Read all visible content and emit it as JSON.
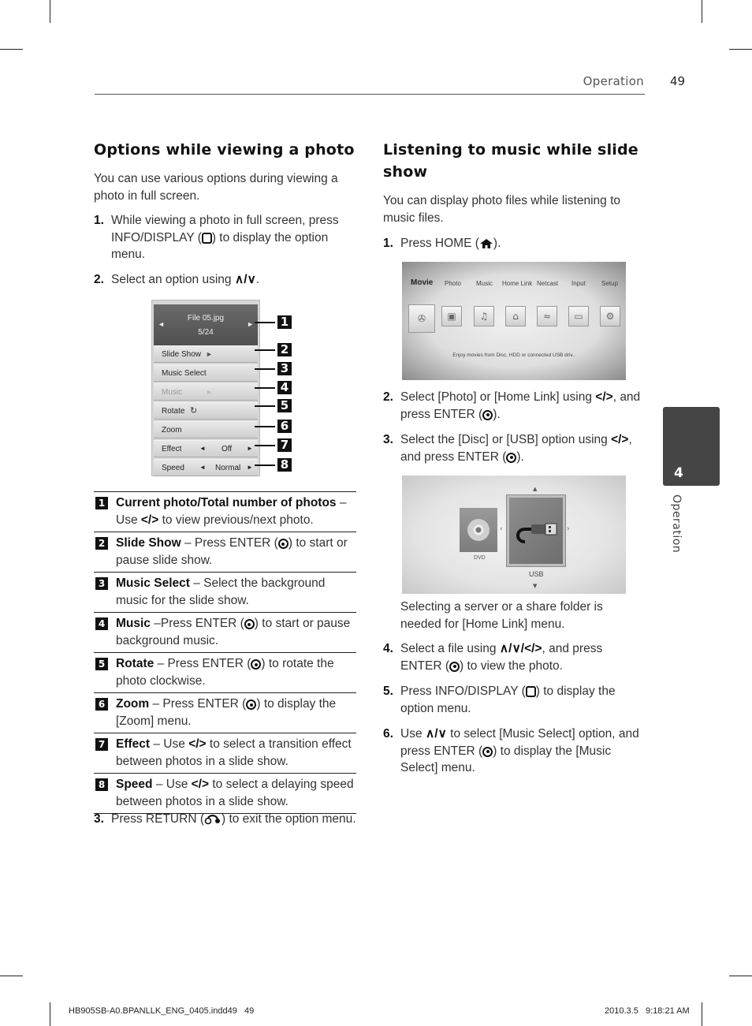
{
  "header": {
    "section": "Operation",
    "page_number": "49"
  },
  "side_tab": {
    "chapter": "4",
    "label": "Operation"
  },
  "left": {
    "title": "Options while viewing a photo",
    "intro": "You can use various options during viewing a photo in full screen.",
    "steps": [
      {
        "num": "1.",
        "pre": "While viewing a photo in full screen, press INFO/DISPLAY (",
        "icon": "info-display-icon",
        "post": ") to display the option menu."
      },
      {
        "num": "2.",
        "pre": "Select an option using ",
        "sym": "∧/∨",
        "post": "."
      }
    ],
    "step3": {
      "num": "3.",
      "pre": "Press RETURN (",
      "icon": "return-icon",
      "post": ") to exit the option menu."
    },
    "option_menu": {
      "file_name": "File 05.jpg",
      "position": "5/24",
      "rows": [
        {
          "label": "Slide Show",
          "extra": "►",
          "dimmed": false
        },
        {
          "label": "Music Select",
          "extra": "",
          "dimmed": false
        },
        {
          "label": "Music",
          "extra": "►",
          "dimmed": true
        },
        {
          "label": "Rotate",
          "extra": "↻",
          "dimmed": false
        },
        {
          "label": "Zoom",
          "extra": "",
          "dimmed": false
        },
        {
          "label": "Effect",
          "value": "Off",
          "dimmed": false
        },
        {
          "label": "Speed",
          "value": "Normal",
          "dimmed": false
        }
      ],
      "callouts": [
        "1",
        "2",
        "3",
        "4",
        "5",
        "6",
        "7",
        "8"
      ]
    },
    "legend": [
      {
        "num": "1",
        "term": "Current photo/Total number of photos",
        "desc_pre": " – Use ",
        "sym": "</>",
        "desc_post": " to view previous/next photo."
      },
      {
        "num": "2",
        "term": "Slide Show",
        "desc_pre": " – Press ENTER (",
        "enter": true,
        "desc_post": ") to start or pause slide show."
      },
      {
        "num": "3",
        "term": "Music Select",
        "desc_pre": " – Select the background music for the slide show.",
        "desc_post": ""
      },
      {
        "num": "4",
        "term": "Music",
        "desc_pre": " –Press ENTER (",
        "enter": true,
        "desc_post": ") to start or pause background music."
      },
      {
        "num": "5",
        "term": "Rotate",
        "desc_pre": " – Press ENTER (",
        "enter": true,
        "desc_post": ") to rotate the photo clockwise."
      },
      {
        "num": "6",
        "term": "Zoom",
        "desc_pre": " – Press ENTER (",
        "enter": true,
        "desc_post": ") to display the [Zoom] menu."
      },
      {
        "num": "7",
        "term": "Effect",
        "desc_pre": " – Use ",
        "sym": "</>",
        "desc_post": " to select a transition effect between photos in a slide show."
      },
      {
        "num": "8",
        "term": "Speed",
        "desc_pre": " – Use ",
        "sym": "</>",
        "desc_post": " to select a delaying speed between photos in a slide show."
      }
    ]
  },
  "right": {
    "title": "Listening to music while slide show",
    "intro": "You can display photo files while listening to music files.",
    "step1": {
      "num": "1.",
      "pre": "Press HOME (",
      "post": ")."
    },
    "home_screen": {
      "menu": [
        "Movie",
        "Photo",
        "Music",
        "Home Link",
        "Netcast",
        "Input",
        "Setup"
      ],
      "active": "Movie",
      "tile_icons": [
        "movie-reel-icon",
        "photo-icon",
        "music-note-icon",
        "home-link-icon",
        "netcast-icon",
        "input-icon",
        "setup-gear-icon"
      ],
      "hint": "Enjoy movies from Disc, HDD or connected USB driv.."
    },
    "step2": {
      "num": "2.",
      "pre": "Select [Photo] or [Home Link] using ",
      "sym": "</>",
      "mid": ", and press ENTER (",
      "post": ")."
    },
    "step3": {
      "num": "3.",
      "pre": "Select the [Disc] or [USB] option using ",
      "sym": "</>",
      "mid": ", and press ENTER (",
      "post": ")."
    },
    "device_screen": {
      "devices": [
        "DVD",
        "USB"
      ],
      "selected": "USB"
    },
    "note": "Selecting a server or a share folder is needed for [Home Link] menu.",
    "step4": {
      "num": "4.",
      "pre": "Select a file using ",
      "sym": "∧/∨/</>",
      "mid": ", and press ENTER (",
      "post": ") to view the photo."
    },
    "step5": {
      "num": "5.",
      "pre": "Press INFO/DISPLAY (",
      "post": ") to display the option menu."
    },
    "step6": {
      "num": "6.",
      "pre": "Use ",
      "sym": "∧/∨",
      "mid": " to select [Music Select] option, and press ENTER (",
      "post": ") to display the [Music Select] menu."
    }
  },
  "footer": {
    "file": "HB905SB-A0.BPANLLK_ENG_0405.indd49   49",
    "timestamp": "2010.3.5   9:18:21 AM"
  }
}
